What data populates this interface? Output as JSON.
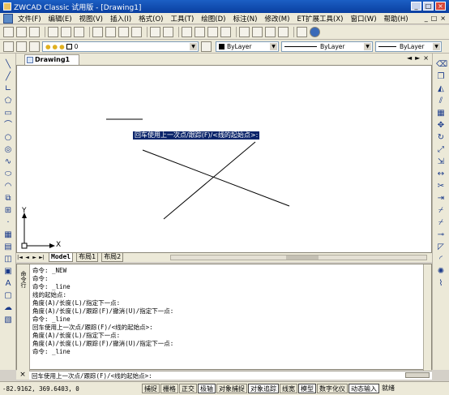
{
  "window": {
    "title": "ZWCAD Classic 试用版 - [Drawing1]",
    "buttons": [
      "_",
      "□",
      "×"
    ]
  },
  "menubar": {
    "items": [
      "文件(F)",
      "编辑(E)",
      "视图(V)",
      "插入(I)",
      "格式(O)",
      "工具(T)",
      "绘图(D)",
      "标注(N)",
      "修改(M)",
      "ET扩展工具(X)",
      "窗口(W)",
      "帮助(H)"
    ],
    "mdi_buttons": [
      "_",
      "□",
      "×"
    ]
  },
  "properties": {
    "layer": "0",
    "color": "ByLayer",
    "linetype": "ByLayer",
    "lineweight": "ByLayer"
  },
  "document": {
    "tab_label": "Drawing1",
    "nav": [
      "◄",
      "►",
      "×"
    ]
  },
  "ucs": {
    "y_label": "Y",
    "x_label": "X"
  },
  "tooltip": "回车使用上一次点/跟踪(F)/<线的起始点>:",
  "layout_tabs": {
    "nav": [
      "|◄",
      "◄",
      "►",
      "►|"
    ],
    "tabs": [
      "Model",
      "布局1",
      "布局2"
    ]
  },
  "command_window": {
    "side_label": "命令行",
    "lines": [
      "命令: _NEW",
      "命令:",
      "命令: _line",
      "线的起始点:",
      "角度(A)/长度(L)/指定下一点:",
      "角度(A)/长度(L)/跟踪(F)/撤消(U)/指定下一点:",
      "命令: _line",
      "回车使用上一次点/跟踪(F)/<线的起始点>:",
      "角度(A)/长度(L)/指定下一点:",
      "角度(A)/长度(L)/跟踪(F)/撤消(U)/指定下一点:",
      "命令: _line"
    ],
    "prompt": "回车使用上一次点/跟踪(F)/<线的起始点>:",
    "close": "×"
  },
  "statusbar": {
    "coords": "-82.9162, 369.6403, 0",
    "toggles": [
      {
        "label": "捕捉",
        "on": false
      },
      {
        "label": "栅格",
        "on": false
      },
      {
        "label": "正交",
        "on": false
      },
      {
        "label": "极轴",
        "on": true
      },
      {
        "label": "对象捕捉",
        "on": false
      },
      {
        "label": "对象追踪",
        "on": true
      },
      {
        "label": "线宽",
        "on": false
      },
      {
        "label": "模型",
        "on": true
      },
      {
        "label": "数字化仪",
        "on": false
      },
      {
        "label": "动态输入",
        "on": true
      },
      {
        "label": "就绪",
        "on": false
      }
    ]
  },
  "colors": {
    "title_bar": "#0a3fa0",
    "canvas": "#ffffff",
    "highlight": "#0a246a"
  }
}
